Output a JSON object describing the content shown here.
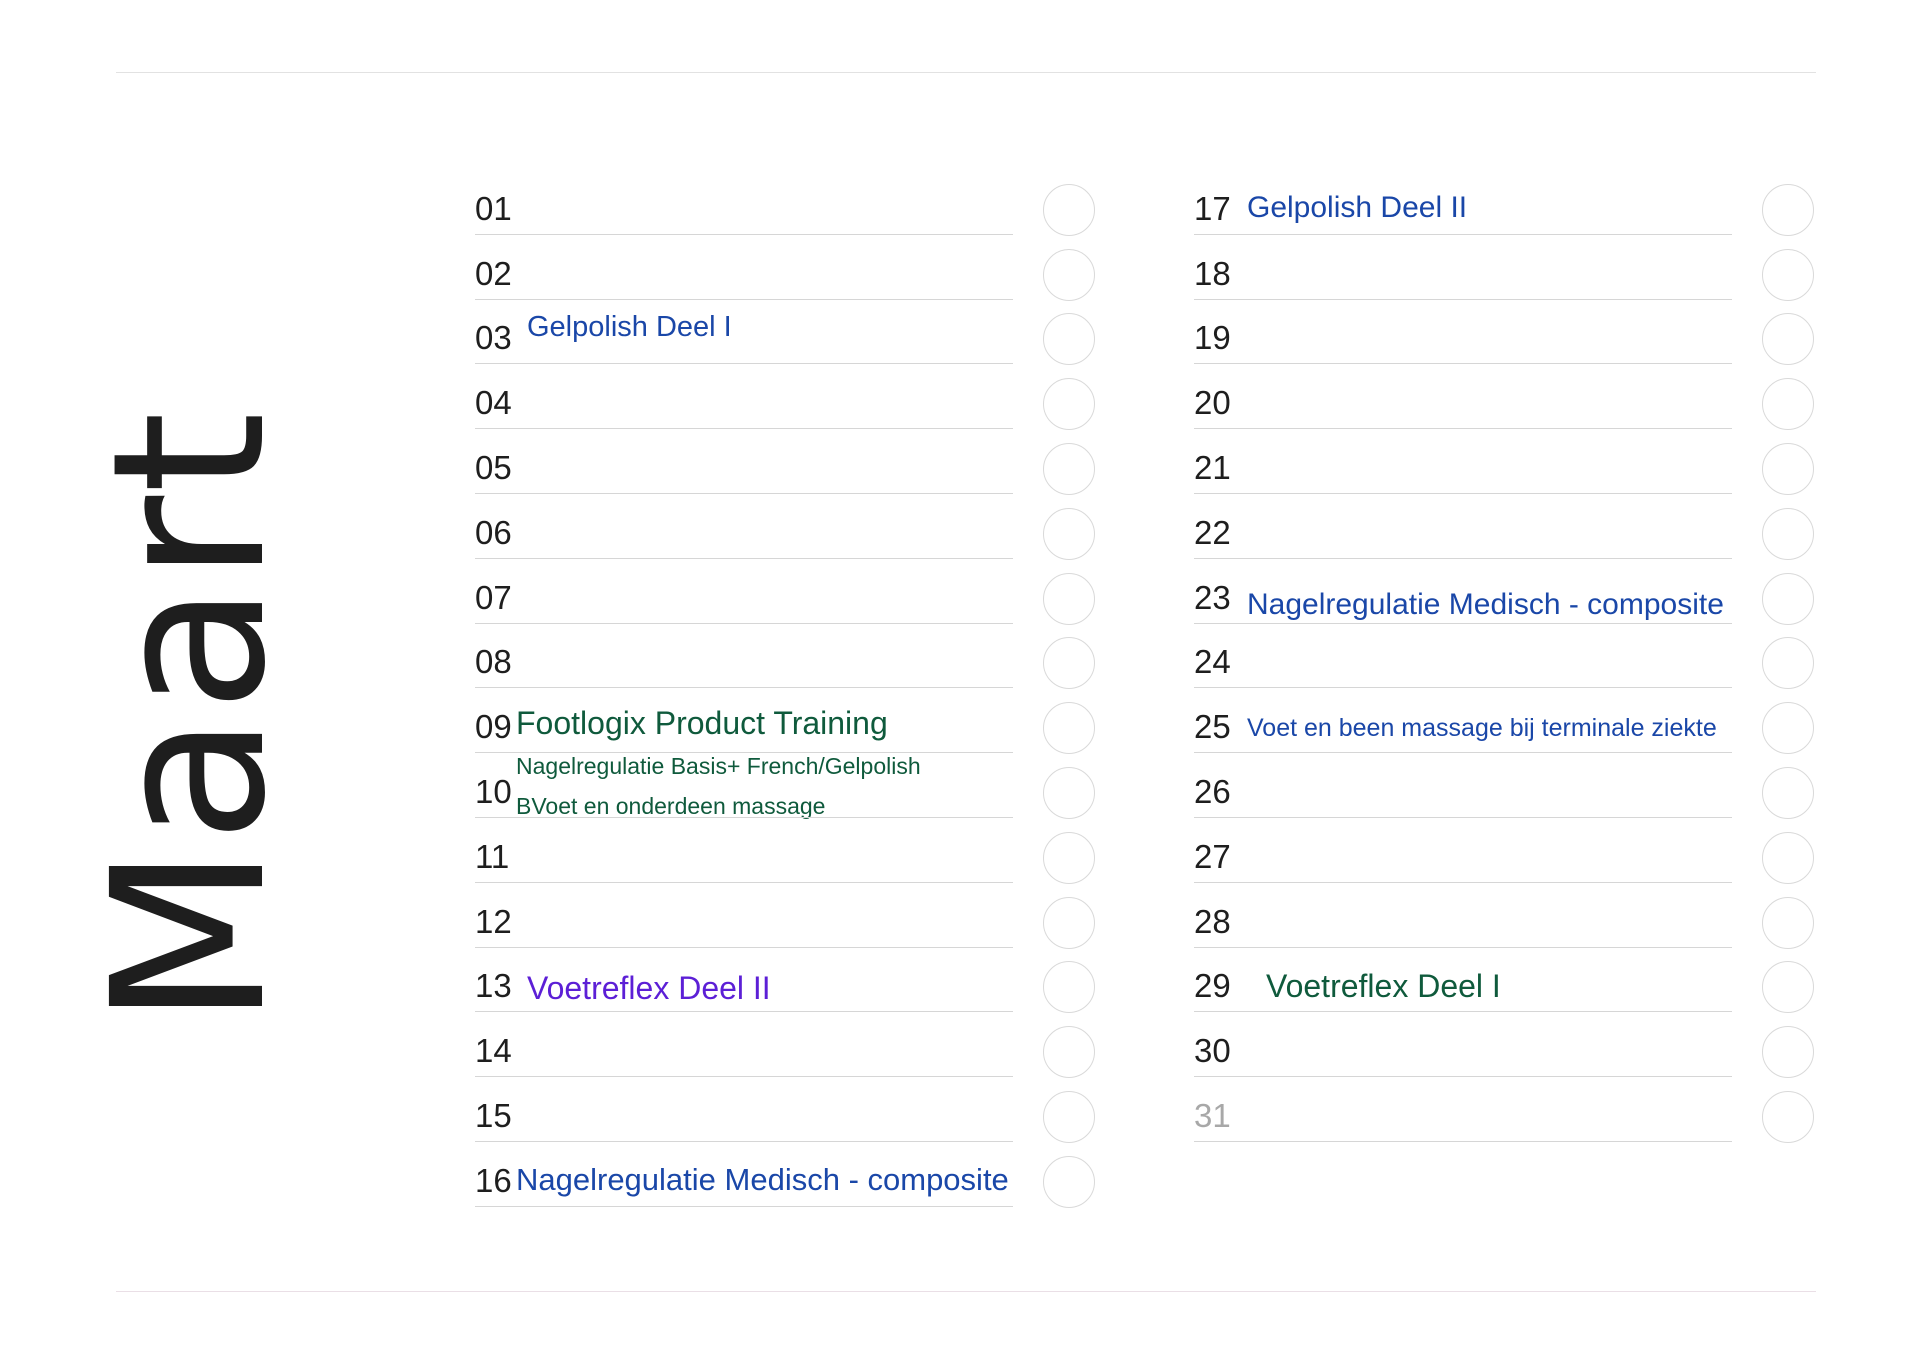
{
  "month": "Maart",
  "days_left": [
    {
      "day": "01",
      "event": "",
      "color": ""
    },
    {
      "day": "02",
      "event": "",
      "color": ""
    },
    {
      "day": "03",
      "event": "Gelpolish Deel I",
      "color": "blue"
    },
    {
      "day": "04",
      "event": "",
      "color": ""
    },
    {
      "day": "05",
      "event": "",
      "color": ""
    },
    {
      "day": "06",
      "event": "",
      "color": ""
    },
    {
      "day": "07",
      "event": "",
      "color": ""
    },
    {
      "day": "08",
      "event": "",
      "color": ""
    },
    {
      "day": "09",
      "event": "Footlogix Product Training",
      "color": "green"
    },
    {
      "day": "10",
      "event": "Nagelregulatie Basis+ French/Gelpolish",
      "event2": "BVoet en onderdeen massage",
      "color": "green"
    },
    {
      "day": "11",
      "event": "",
      "color": ""
    },
    {
      "day": "12",
      "event": "",
      "color": ""
    },
    {
      "day": "13",
      "event": "Voetreflex Deel II",
      "color": "purple"
    },
    {
      "day": "14",
      "event": "",
      "color": ""
    },
    {
      "day": "15",
      "event": "",
      "color": ""
    },
    {
      "day": "16",
      "event": "Nagelregulatie Medisch - composite",
      "color": "blue"
    }
  ],
  "days_right": [
    {
      "day": "17",
      "event": "Gelpolish Deel II",
      "color": "blue"
    },
    {
      "day": "18",
      "event": "",
      "color": ""
    },
    {
      "day": "19",
      "event": "",
      "color": ""
    },
    {
      "day": "20",
      "event": "",
      "color": ""
    },
    {
      "day": "21",
      "event": "",
      "color": ""
    },
    {
      "day": "22",
      "event": "",
      "color": ""
    },
    {
      "day": "23",
      "event": "Nagelregulatie Medisch - composite",
      "color": "blue"
    },
    {
      "day": "24",
      "event": "",
      "color": ""
    },
    {
      "day": "25",
      "event": "Voet en been massage bij terminale ziekte",
      "color": "blue"
    },
    {
      "day": "26",
      "event": "",
      "color": ""
    },
    {
      "day": "27",
      "event": "",
      "color": ""
    },
    {
      "day": "28",
      "event": "",
      "color": ""
    },
    {
      "day": "29",
      "event": "Voetreflex Deel I",
      "color": "green"
    },
    {
      "day": "30",
      "event": "",
      "color": ""
    },
    {
      "day": "31",
      "event": "",
      "color": "",
      "muted": true
    }
  ],
  "colors": {
    "blue": "#1a47a8",
    "green": "#0f5a3c",
    "purple": "#5c1fd6"
  }
}
